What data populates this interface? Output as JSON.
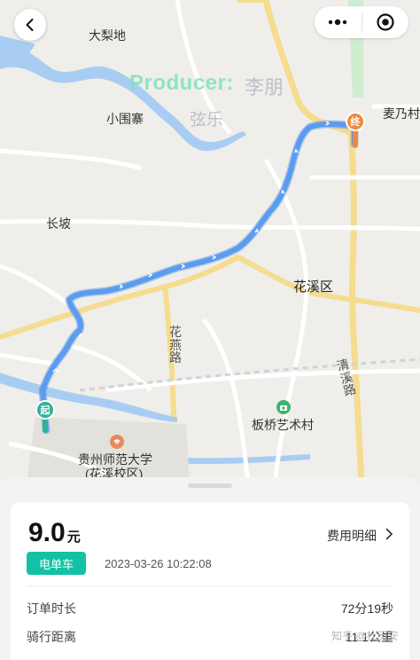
{
  "map": {
    "places": {
      "dalidi": "大梨地",
      "xiaoweizhai": "小围寨",
      "changpo": "长坡",
      "huaxi": "花溪区",
      "mainaicun": "麦乃村",
      "banqiao": "板桥艺术村",
      "university_line1": "贵州师范大学",
      "university_line2": "(花溪校区)"
    },
    "roads": {
      "huayan": "花燕路",
      "qingxi": "清溪路"
    },
    "watermark": {
      "producer": "Producer:",
      "name": "李朋",
      "sub": "弦乐"
    },
    "pins": {
      "start": "起",
      "end": "终"
    },
    "colors": {
      "route": "#5b9bf0",
      "start_pin": "#2bb39a",
      "end_pin": "#f08a3a"
    },
    "icons": {
      "back": "chevron-left-icon",
      "more": "more-dots-icon",
      "close": "target-close-icon"
    }
  },
  "trip": {
    "price": "9.0",
    "price_unit": "元",
    "fee_detail": "费用明细",
    "vehicle_badge": "电单车",
    "order_time": "2023-03-26 10:22:08",
    "rows": [
      {
        "label": "订单时长",
        "value": "72分19秒"
      },
      {
        "label": "骑行距离",
        "value": "11.1公里"
      }
    ],
    "badge_color": "#13c2a4"
  },
  "footer_watermark": "知乎 @杜历安"
}
